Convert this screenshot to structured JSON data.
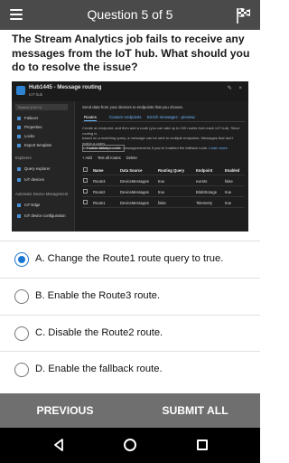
{
  "header": {
    "title": "Question 5 of 5",
    "menu_icon": "hamburger-menu-icon",
    "finish_icon": "checkered-flag-icon"
  },
  "question": {
    "text": "The Stream Analytics job fails to receive any messages from the IoT hub. What should you do to resolve the issue?"
  },
  "screenshot": {
    "title": "Hub1445 - Message routing",
    "subtitle": "IoT hub",
    "search_placeholder": "Search (Ctrl+/)",
    "sidebar": [
      {
        "label": "Failover"
      },
      {
        "label": "Properties"
      },
      {
        "label": "Locks"
      },
      {
        "label": "Export template"
      }
    ],
    "section_explorers": "Explorers",
    "explorers": [
      {
        "label": "Query explorer"
      },
      {
        "label": "IoT devices"
      }
    ],
    "section_adm": "Automatic Device Management",
    "adm_items": [
      {
        "label": "IoT Edge"
      },
      {
        "label": "IoT device configuration"
      }
    ],
    "description": "Send data from your devices to endpoints that you choose.",
    "tabs": [
      "Routes",
      "Custom endpoints",
      "Enrich messages - preview"
    ],
    "para_line1": "Create an endpoint, and then add a route (you can add up to 100 routes from each IoT hub). Since routing is",
    "para_line2": "based on a matching query, a message can be sent to multiple endpoints. Messages that don't match a query",
    "para_line3": "are automatically sent to messages/events if you've enabled the fallback route.",
    "learn_more": "Learn more",
    "fallback_button": "Enable fallback route",
    "actions": [
      "+ Add",
      "Test all routes",
      "Delete"
    ],
    "columns": [
      "Name",
      "Data Source",
      "Routing Query",
      "Endpoint",
      "Enabled"
    ],
    "rows": [
      [
        "Route3",
        "DeviceMessages",
        "true",
        "events",
        "false"
      ],
      [
        "Route2",
        "DeviceMessages",
        "true",
        "BlobStorage",
        "true"
      ],
      [
        "Route1",
        "DeviceMessages",
        "false",
        "Telemetry",
        "true"
      ]
    ]
  },
  "options": [
    {
      "label": "A. Change the Route1 route query to true.",
      "selected": true
    },
    {
      "label": "B. Enable the Route3 route.",
      "selected": false
    },
    {
      "label": "C. Disable the Route2 route.",
      "selected": false
    },
    {
      "label": "D. Enable the fallback route.",
      "selected": false
    }
  ],
  "buttons": {
    "previous": "PREVIOUS",
    "submit": "SUBMIT ALL"
  },
  "colors": {
    "appbar": "#4a4a4a",
    "accent": "#1976d2",
    "button_bar": "#6f6f6f"
  }
}
